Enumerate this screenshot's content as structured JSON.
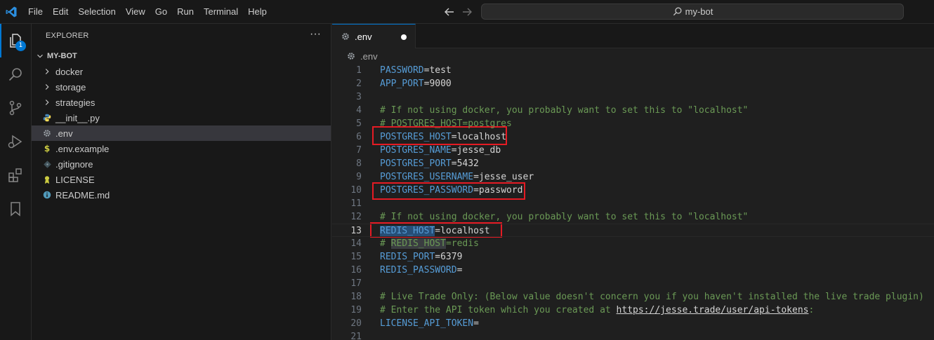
{
  "menu": [
    "File",
    "Edit",
    "Selection",
    "View",
    "Go",
    "Run",
    "Terminal",
    "Help"
  ],
  "search": {
    "text": "my-bot"
  },
  "activity": {
    "explorer_badge": "1"
  },
  "sidebar": {
    "title": "EXPLORER",
    "more": "···",
    "root": "MY-BOT",
    "items": [
      {
        "label": "docker",
        "type": "folder"
      },
      {
        "label": "storage",
        "type": "folder"
      },
      {
        "label": "strategies",
        "type": "folder"
      },
      {
        "label": "__init__.py",
        "type": "python"
      },
      {
        "label": ".env",
        "type": "env",
        "selected": true
      },
      {
        "label": ".env.example",
        "type": "dollar"
      },
      {
        "label": ".gitignore",
        "type": "git"
      },
      {
        "label": "LICENSE",
        "type": "license"
      },
      {
        "label": "README.md",
        "type": "info"
      }
    ]
  },
  "tab": {
    "label": ".env"
  },
  "breadcrumb": {
    "label": ".env"
  },
  "editor": {
    "current_line": 13,
    "lines": [
      {
        "n": "1",
        "key": "PASSWORD",
        "val": "test"
      },
      {
        "n": "2",
        "key": "APP_PORT",
        "val": "9000"
      },
      {
        "n": "3"
      },
      {
        "n": "4",
        "comment": "# If not using docker, you probably want to set this to \"localhost\""
      },
      {
        "n": "5",
        "comment": "# POSTGRES_HOST=postgres"
      },
      {
        "n": "6",
        "key": "POSTGRES_HOST",
        "val": "localhost"
      },
      {
        "n": "7",
        "key": "POSTGRES_NAME",
        "val": "jesse_db"
      },
      {
        "n": "8",
        "key": "POSTGRES_PORT",
        "val": "5432"
      },
      {
        "n": "9",
        "key": "POSTGRES_USERNAME",
        "val": "jesse_user"
      },
      {
        "n": "10",
        "key": "POSTGRES_PASSWORD",
        "val": "password"
      },
      {
        "n": "11"
      },
      {
        "n": "12",
        "comment": "# If not using docker, you probably want to set this to \"localhost\""
      },
      {
        "n": "13",
        "key": "REDIS_HOST",
        "val": "localhost"
      },
      {
        "n": "14",
        "comment_pre": "# ",
        "comment_hl": "REDIS_HOST",
        "comment_post": "=redis"
      },
      {
        "n": "15",
        "key": "REDIS_PORT",
        "val": "6379"
      },
      {
        "n": "16",
        "key": "REDIS_PASSWORD",
        "val": ""
      },
      {
        "n": "17"
      },
      {
        "n": "18",
        "comment": "# Live Trade Only: (Below value doesn't concern you if you haven't installed the live trade plugin)"
      },
      {
        "n": "19",
        "comment_pre": "# Enter the API token which you created at ",
        "link": "https://jesse.trade/user/api-tokens",
        "comment_post": ":"
      },
      {
        "n": "20",
        "key": "LICENSE_API_TOKEN",
        "val": ""
      },
      {
        "n": "21"
      }
    ]
  },
  "colors": {
    "accent": "#0078d4",
    "annotation": "#e51b24"
  }
}
